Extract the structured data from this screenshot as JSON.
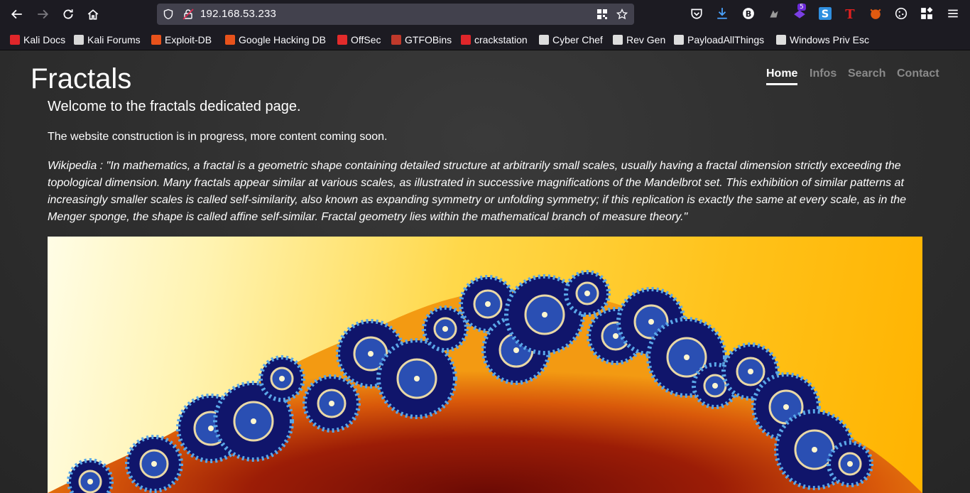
{
  "browser": {
    "url": "192.168.53.233",
    "extension_badge": "5"
  },
  "bookmarks": [
    {
      "label": "Kali Docs",
      "icon": "kali-docs-icon",
      "color": "#e0262a"
    },
    {
      "label": "Kali Forums",
      "icon": "kali-dragon-icon",
      "color": "#d8d8d8"
    },
    {
      "label": "Exploit-DB",
      "icon": "exploit-db-icon",
      "color": "#e8521b"
    },
    {
      "label": "Google Hacking DB",
      "icon": "ghdb-icon",
      "color": "#e8521b"
    },
    {
      "label": "OffSec",
      "icon": "offsec-icon",
      "color": "#e32b2b"
    },
    {
      "label": "GTFOBins",
      "icon": "gtfobins-icon",
      "color": "#c0392b"
    },
    {
      "label": "crackstation",
      "icon": "crackstation-icon",
      "color": "#e0262a"
    },
    {
      "label": "Cyber Chef",
      "icon": "cyberchef-icon",
      "color": "#dddddd"
    },
    {
      "label": "Rev Gen",
      "icon": "skull-icon",
      "color": "#dddddd"
    },
    {
      "label": "PayloadAllThings",
      "icon": "github-icon",
      "color": "#dddddd"
    },
    {
      "label": "Windows Priv Esc",
      "icon": "book-icon",
      "color": "#dddddd"
    }
  ],
  "site": {
    "brand": "Fractals",
    "nav": [
      {
        "label": "Home",
        "active": true
      },
      {
        "label": "Infos",
        "active": false
      },
      {
        "label": "Search",
        "active": false
      },
      {
        "label": "Contact",
        "active": false
      }
    ],
    "lead": "Welcome to the fractals dedicated page.",
    "paragraph": "The website construction is in progress, more content coming soon.",
    "quote": "Wikipedia : \"In mathematics, a fractal is a geometric shape containing detailed structure at arbitrarily small scales, usually having a fractal dimension strictly exceeding the topological dimension. Many fractals appear similar at various scales, as illustrated in successive magnifications of the Mandelbrot set. This exhibition of similar patterns at increasingly smaller scales is called self-similarity, also known as expanding symmetry or unfolding symmetry; if this replication is exactly the same at every scale, as in the Menger sponge, the shape is called affine self-similar. Fractal geometry lies within the mathematical branch of measure theory.\""
  }
}
